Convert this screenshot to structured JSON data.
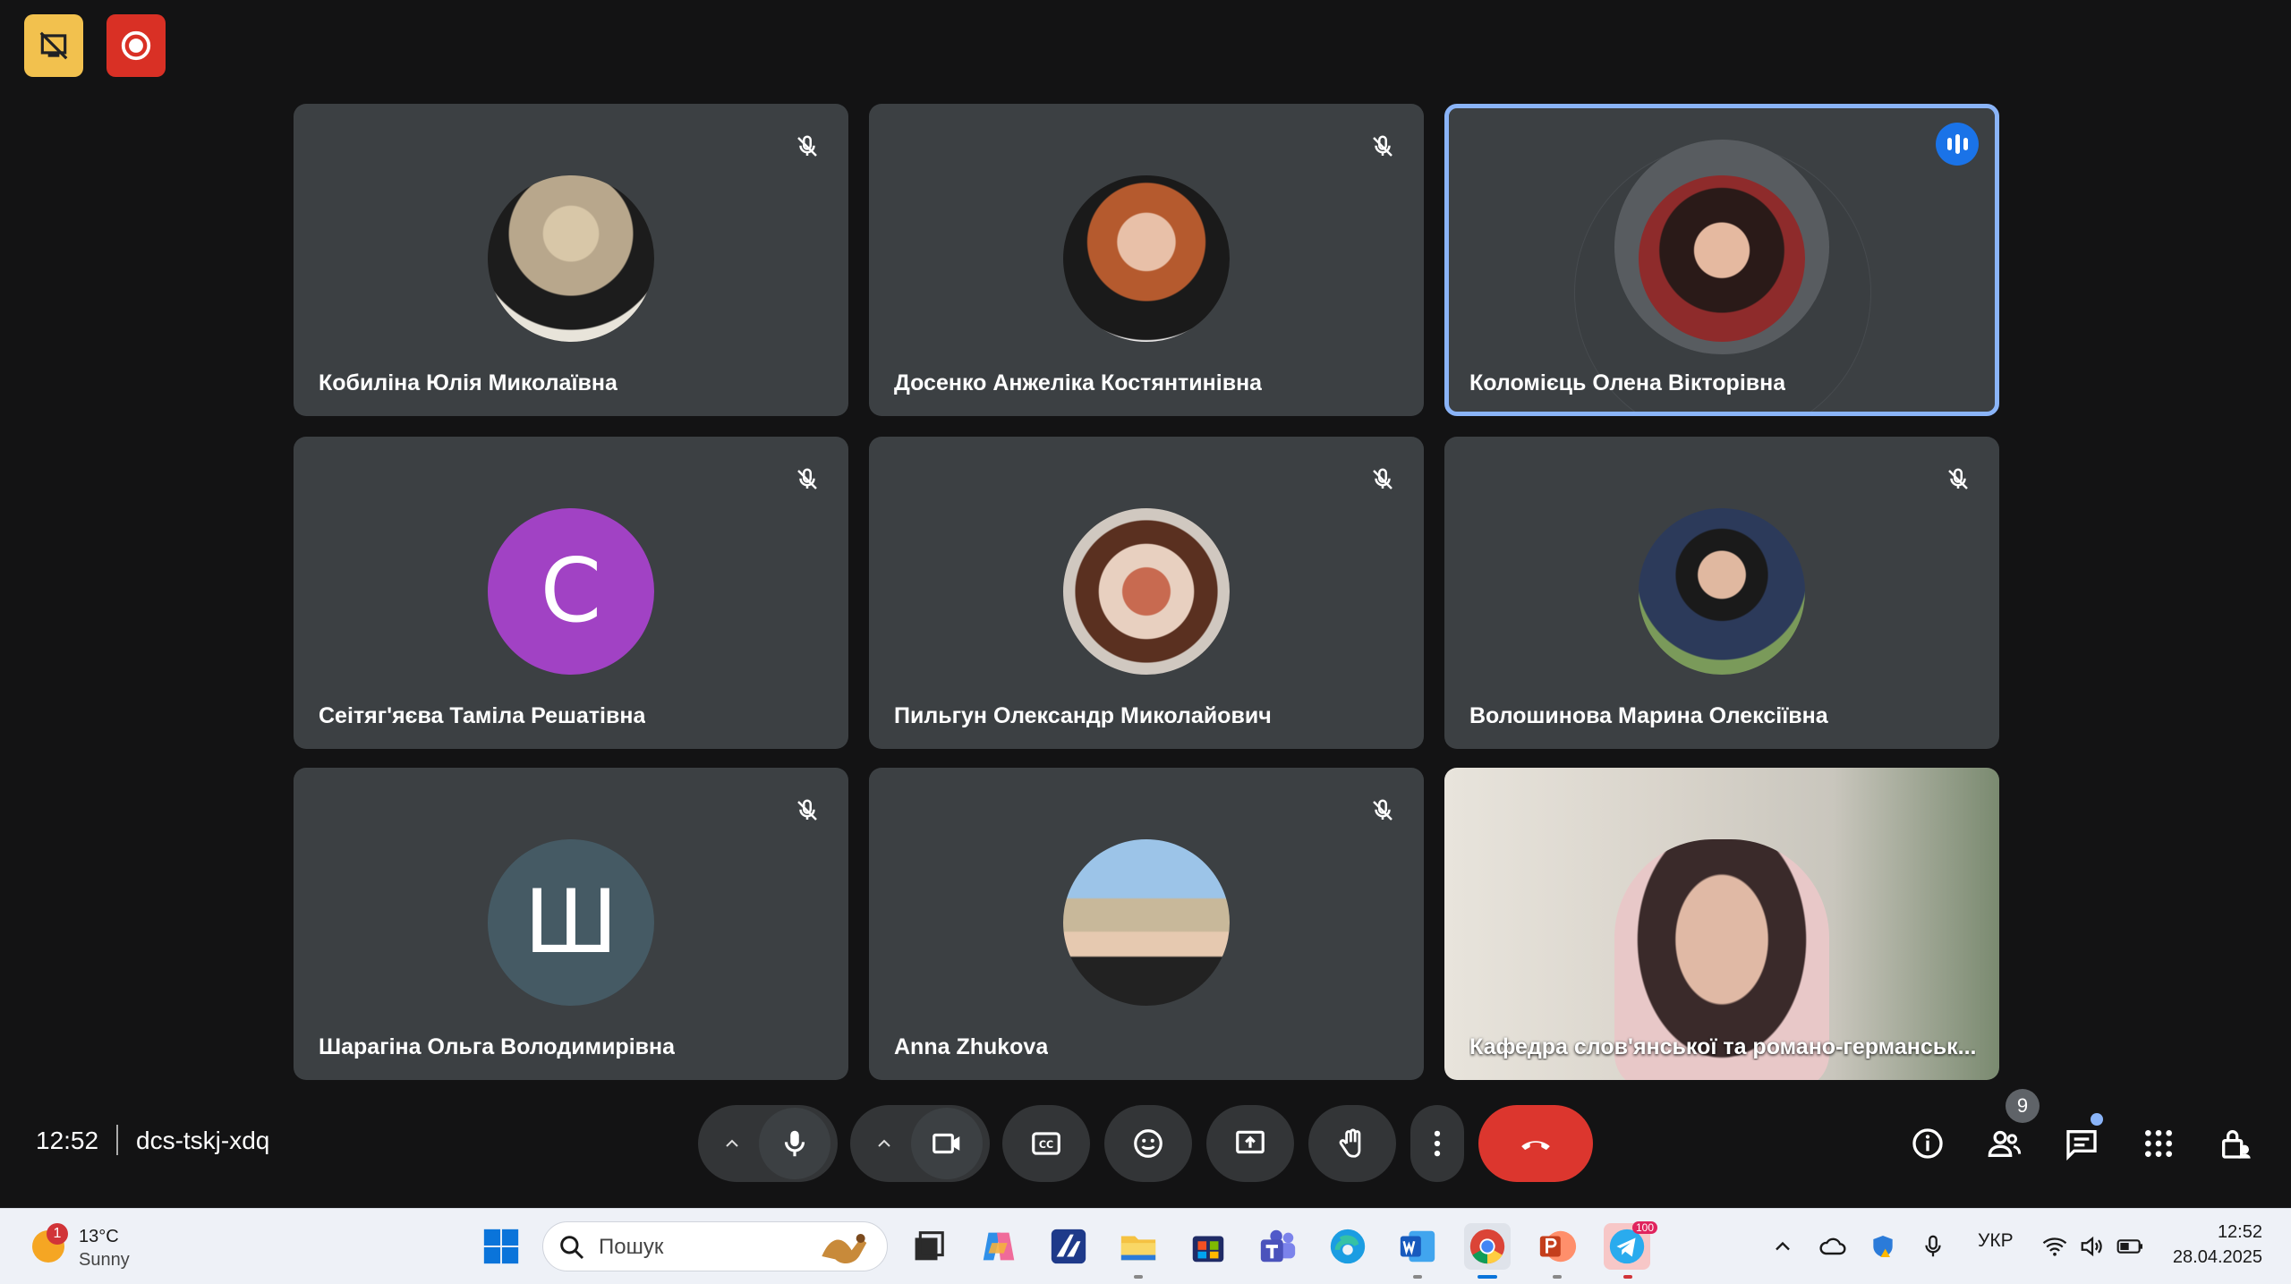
{
  "top_buttons": {
    "left_color": "#f2c14e",
    "right_color": "#d93025"
  },
  "participants": [
    {
      "name": "Кобиліна Юлія Миколаївна",
      "type": "photo",
      "muted": true
    },
    {
      "name": "Досенко Анжеліка Костянтинівна",
      "type": "photo",
      "muted": true
    },
    {
      "name": "Коломієць Олена Вікторівна",
      "type": "photo",
      "speaking": true
    },
    {
      "name": "Сеітяг'яєва Таміла Решатівна",
      "type": "letter",
      "initial": "С",
      "color": "#a142c4",
      "muted": true
    },
    {
      "name": "Пильгун Олександр Миколайович",
      "type": "photo",
      "muted": true
    },
    {
      "name": "Волошинова Марина Олексіївна",
      "type": "photo",
      "muted": true
    },
    {
      "name": "Шарагіна Ольга Володимирівна",
      "type": "letter",
      "initial": "Ш",
      "color": "#455a64",
      "muted": true
    },
    {
      "name": "Anna Zhukova",
      "type": "photo",
      "muted": true
    },
    {
      "name": "Кафедра слов'янської та романо-германськ...",
      "type": "video"
    }
  ],
  "meeting": {
    "time": "12:52",
    "code": "dcs-tskj-xdq",
    "people_count": "9"
  },
  "taskbar": {
    "weather_temp": "13°C",
    "weather_desc": "Sunny",
    "weather_badge": "1",
    "search_placeholder": "Пошук",
    "language": "УКР",
    "clock_time": "12:52",
    "clock_date": "28.04.2025",
    "telegram_badge": "100"
  }
}
